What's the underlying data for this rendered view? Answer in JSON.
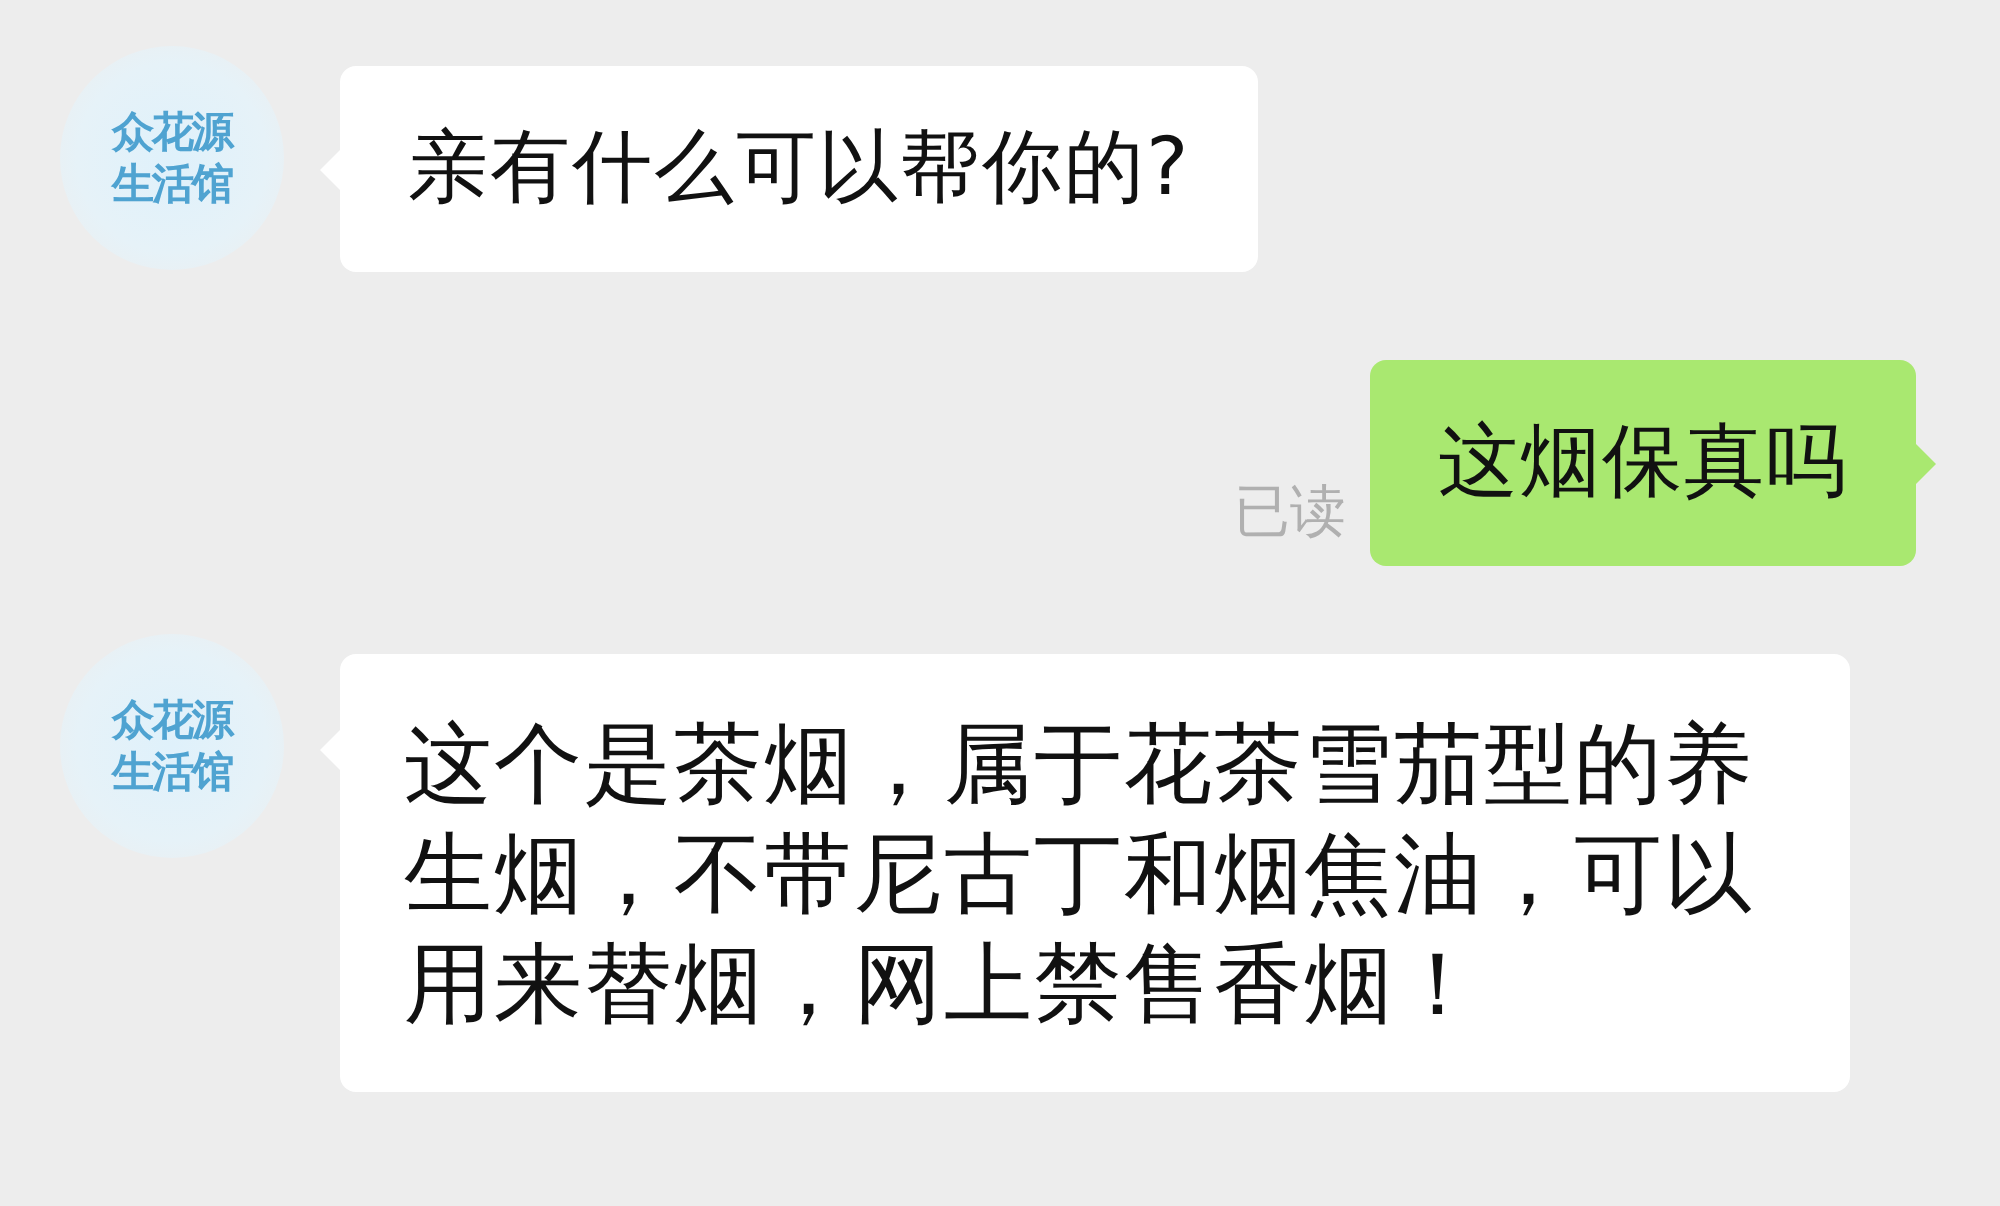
{
  "messages": [
    {
      "kind": "incoming",
      "avatar": {
        "lines": [
          "众花源",
          "生活馆"
        ]
      },
      "text": "亲有什么可以帮你的?"
    },
    {
      "kind": "outgoing",
      "status": "已读",
      "text": "这烟保真吗"
    },
    {
      "kind": "incoming",
      "avatar": {
        "lines": [
          "众花源",
          "生活馆"
        ]
      },
      "text": "这个是茶烟，属于花茶雪茄型的养生烟，不带尼古丁和烟焦油，可以用来替烟，网上禁售香烟！"
    }
  ]
}
